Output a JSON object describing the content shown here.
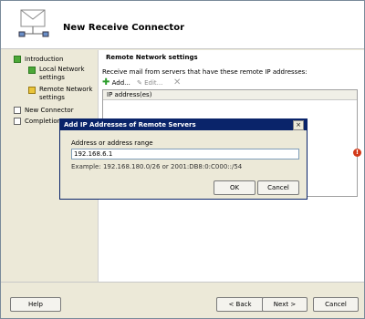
{
  "wizard": {
    "title": "New Receive Connector",
    "steps": [
      {
        "label": "Introduction",
        "state": "done"
      },
      {
        "label": "Local Network settings",
        "state": "done"
      },
      {
        "label": "Remote Network settings",
        "state": "active"
      },
      {
        "label": "New Connector",
        "state": "pending"
      },
      {
        "label": "Completion",
        "state": "pending"
      }
    ]
  },
  "content": {
    "section_title": "Remote Network settings",
    "description": "Receive mail from servers that have these remote IP addresses:",
    "toolbar": {
      "add": "Add...",
      "edit": "Edit..."
    },
    "list_header": "IP address(es)"
  },
  "footer": {
    "help": "Help",
    "back": "< Back",
    "next": "Next >",
    "cancel": "Cancel"
  },
  "dialog": {
    "title": "Add IP Addresses of Remote Servers",
    "close": "×",
    "field_label": "Address or address range",
    "field_value": "192.168.6.1",
    "example": "Example: 192.168.180.0/26 or 2001:DB8:0:C000::/54",
    "ok": "OK",
    "cancel": "Cancel"
  },
  "colors": {
    "titlebar": "#0a246a",
    "done": "#4ca838",
    "active": "#e9c43a",
    "error": "#d23a1a"
  },
  "icons": [
    "wizard-envelope-icon",
    "add-icon",
    "edit-icon",
    "remove-icon",
    "error-icon"
  ]
}
